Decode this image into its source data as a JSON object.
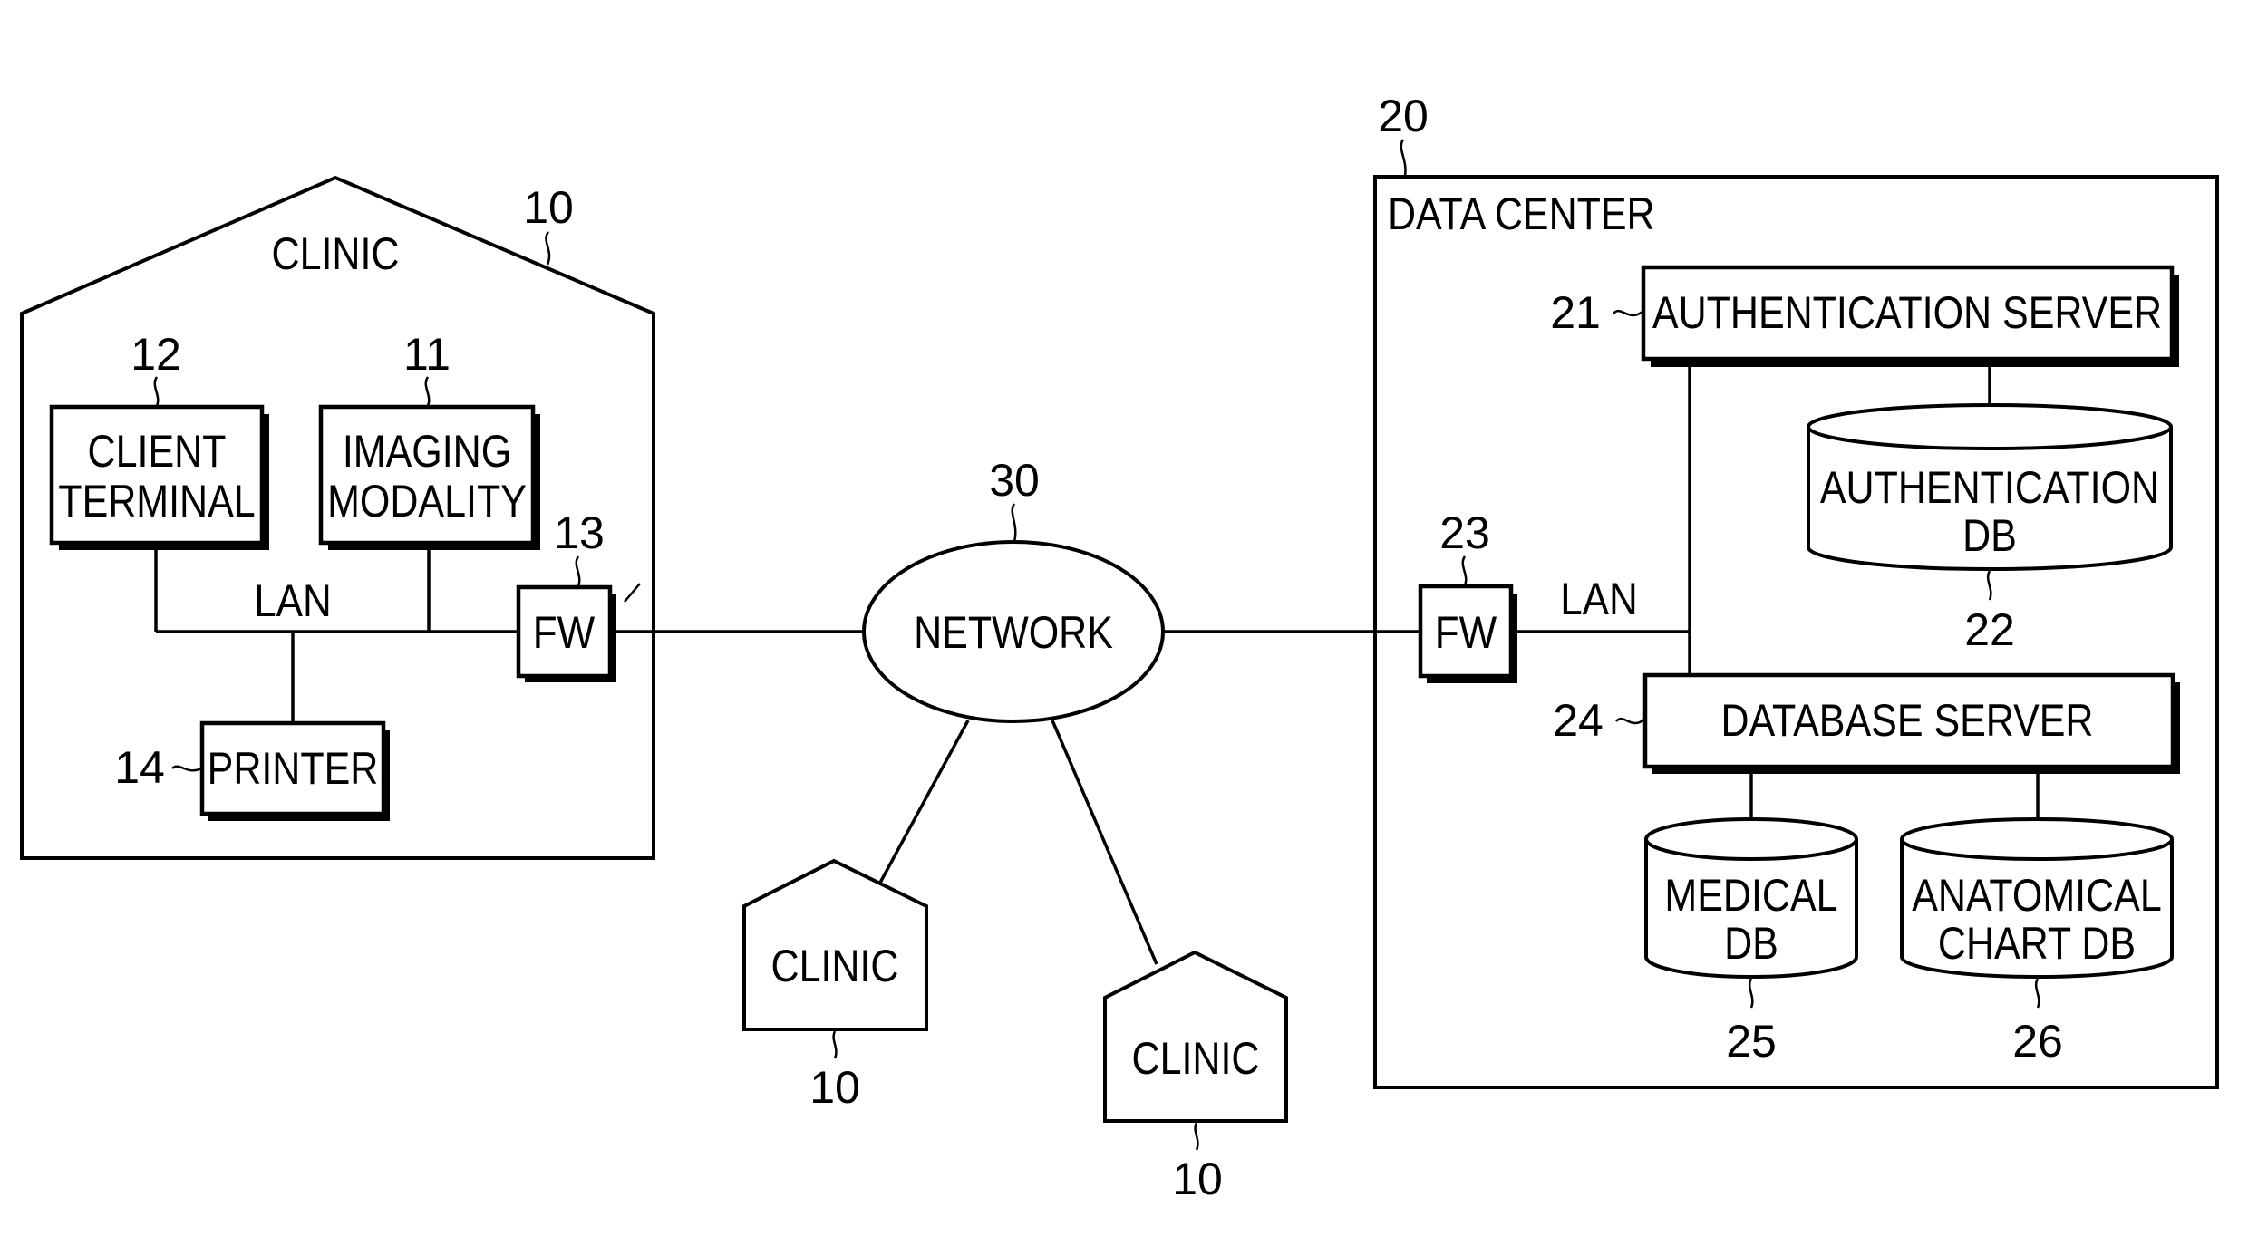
{
  "diagram": {
    "clinic_main": {
      "title": "CLINIC",
      "ref": "10",
      "lan_label": "LAN",
      "client_terminal": {
        "line1": "CLIENT",
        "line2": "TERMINAL",
        "ref": "12"
      },
      "imaging_modality": {
        "line1": "IMAGING",
        "line2": "MODALITY",
        "ref": "11"
      },
      "firewall": {
        "label": "FW",
        "ref": "13"
      },
      "printer": {
        "label": "PRINTER",
        "ref": "14"
      }
    },
    "network": {
      "label": "NETWORK",
      "ref": "30"
    },
    "remote_clinics": [
      {
        "label": "CLINIC",
        "ref": "10"
      },
      {
        "label": "CLINIC",
        "ref": "10"
      }
    ],
    "data_center": {
      "title": "DATA CENTER",
      "ref": "20",
      "lan_label": "LAN",
      "firewall": {
        "label": "FW",
        "ref": "23"
      },
      "authentication_server": {
        "label": "AUTHENTICATION SERVER",
        "ref": "21"
      },
      "authentication_db": {
        "line1": "AUTHENTICATION",
        "line2": "DB",
        "ref": "22"
      },
      "database_server": {
        "label": "DATABASE SERVER",
        "ref": "24"
      },
      "medical_db": {
        "line1": "MEDICAL",
        "line2": "DB",
        "ref": "25"
      },
      "anatomical_chart_db": {
        "line1": "ANATOMICAL",
        "line2": "CHART DB",
        "ref": "26"
      }
    },
    "connections": [
      [
        "client_terminal",
        "clinic_lan"
      ],
      [
        "imaging_modality",
        "clinic_lan"
      ],
      [
        "printer",
        "clinic_lan"
      ],
      [
        "clinic_lan",
        "firewall_13"
      ],
      [
        "firewall_13",
        "network"
      ],
      [
        "network",
        "remote_clinic_1"
      ],
      [
        "network",
        "remote_clinic_2"
      ],
      [
        "network",
        "firewall_23"
      ],
      [
        "firewall_23",
        "data_center_lan"
      ],
      [
        "data_center_lan",
        "authentication_server"
      ],
      [
        "data_center_lan",
        "database_server"
      ],
      [
        "authentication_server",
        "authentication_db"
      ],
      [
        "database_server",
        "medical_db"
      ],
      [
        "database_server",
        "anatomical_chart_db"
      ]
    ]
  }
}
